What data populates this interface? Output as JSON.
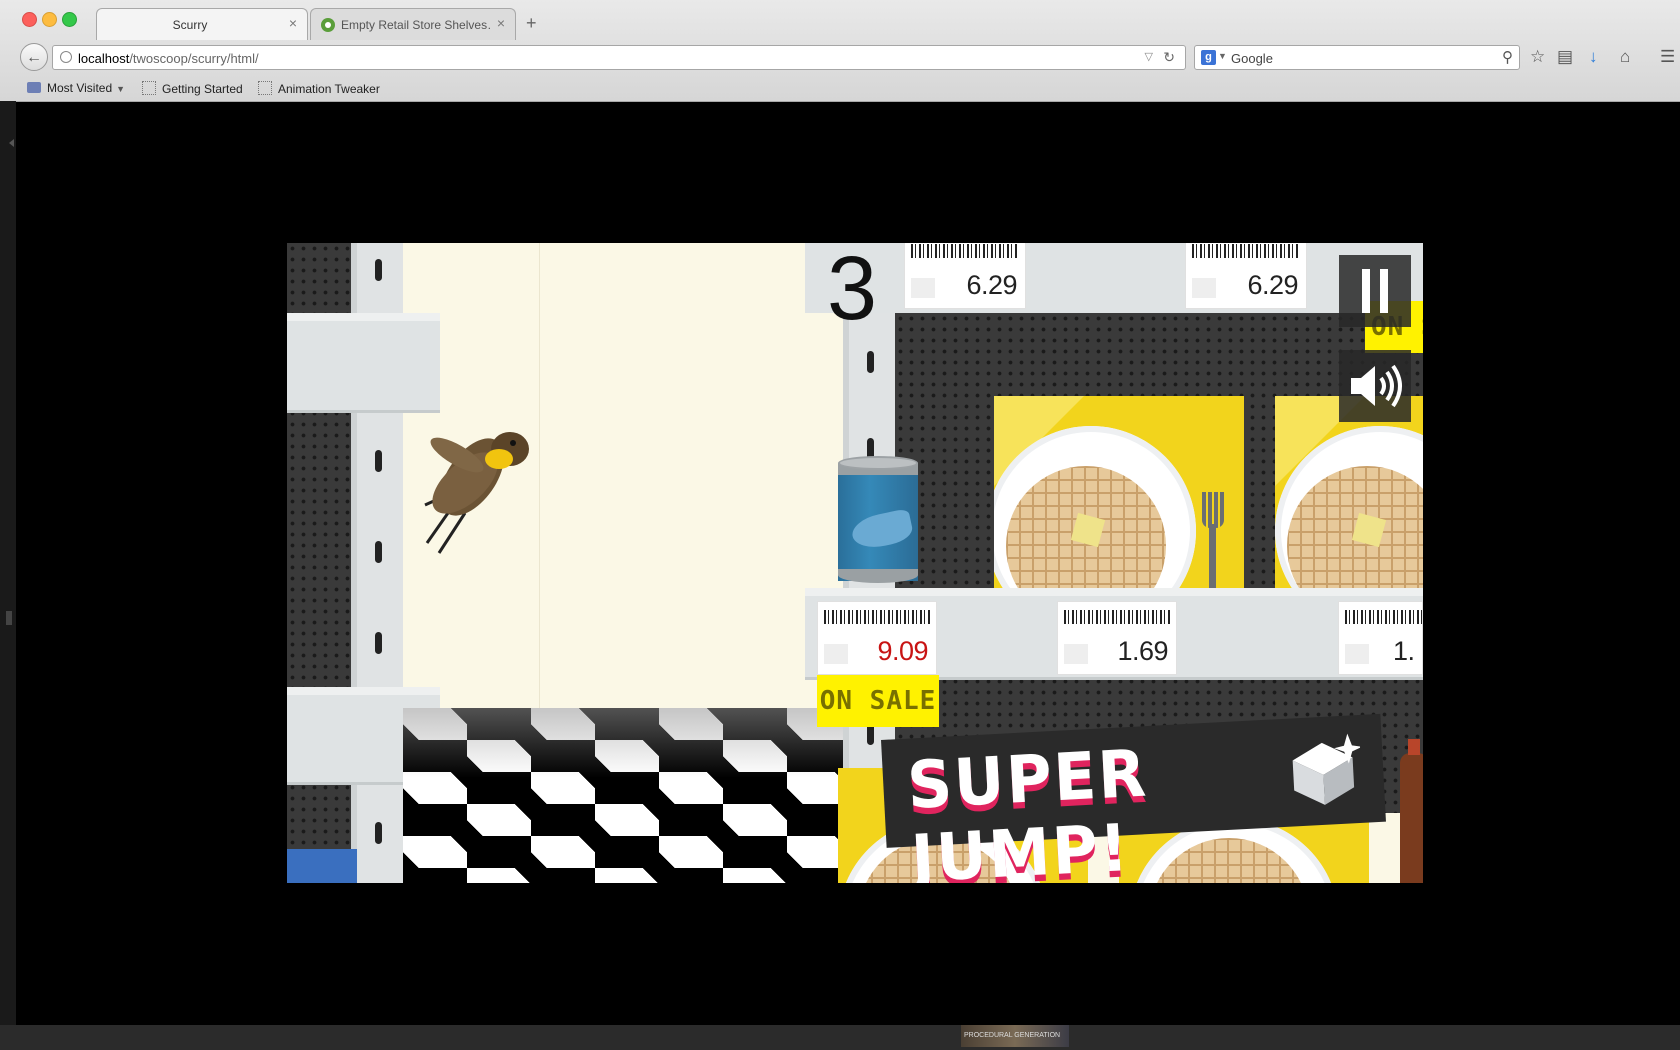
{
  "browser": {
    "tabs": [
      {
        "label": "Scurry",
        "active": true
      },
      {
        "label": "Empty Retail Store Shelves…",
        "active": false
      }
    ],
    "url": {
      "host": "localhost",
      "path": "/twoscoop/scurry/html/"
    },
    "search": {
      "engine": "Google",
      "placeholder": "Google"
    },
    "bookmarks": [
      "Most Visited",
      "Getting Started",
      "Animation Tweaker"
    ]
  },
  "game": {
    "score": "3",
    "price_tags": {
      "top_left": "6.29",
      "top_right": "6.29",
      "mid_left": "9.09",
      "mid_center": "1.69",
      "mid_right": "1."
    },
    "on_sale_label": "ON SALE",
    "on_sale_partial": "ON S",
    "powerup_banner": "SUPER JUMP!",
    "controls": {
      "pause": "pause-icon",
      "sound": "speaker-icon"
    }
  },
  "taskbar": {
    "thumbnail_label": "PROCEDURAL GENERATION"
  },
  "colors": {
    "sale_yellow": "#fff200",
    "sale_red": "#c81414",
    "waffle_box": "#f2d41c",
    "banner_pink": "#e0245e"
  }
}
